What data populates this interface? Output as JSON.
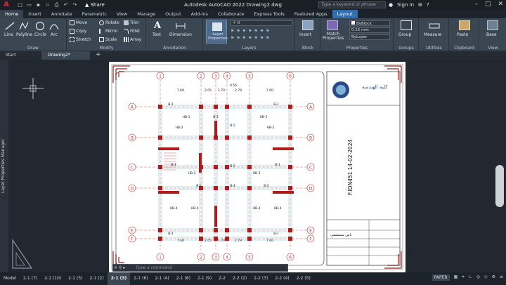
{
  "titlebar": {
    "app_logo": "A",
    "share": "Share",
    "title": "Autodesk AutoCAD 2022    Drawing2.dwg",
    "search_placeholder": "Type a keyword or phrase",
    "sign_in": "Sign In"
  },
  "ribbon_tabs": [
    "Home",
    "Insert",
    "Annotate",
    "Parametric",
    "View",
    "Manage",
    "Output",
    "Add-ins",
    "Collaborate",
    "Express Tools",
    "Featured Apps",
    "Layout"
  ],
  "ribbon": {
    "draw": {
      "line": "Line",
      "polyline": "Polyline",
      "circle": "Circle",
      "arc": "Arc",
      "label": "Draw"
    },
    "modify": {
      "move": "Move",
      "rotate": "Rotate",
      "trim": "Trim",
      "copy": "Copy",
      "mirror": "Mirror",
      "fillet": "Fillet",
      "stretch": "Stretch",
      "scale": "Scale",
      "array": "Array",
      "label": "Modify"
    },
    "annotation": {
      "text": "Text",
      "dimension": "Dimension",
      "label": "Annotation"
    },
    "layers": {
      "layer_properties": "Layer Properties",
      "layer_value": "0",
      "label": "Layers"
    },
    "block": {
      "insert": "Insert",
      "label": "Block"
    },
    "properties": {
      "match": "Match Properties",
      "color": "ByBlock",
      "lineweight": "0.15 mm",
      "linetype": "ByLayer",
      "label": "Properties"
    },
    "groups": {
      "group": "Group",
      "label": "Groups"
    },
    "utilities": {
      "measure": "Measure",
      "label": "Utilities"
    },
    "clipboard": {
      "paste": "Paste",
      "label": "Clipboard"
    },
    "view": {
      "base": "Base",
      "label": "View"
    }
  },
  "file_tabs": [
    "Start",
    "Drawing2*"
  ],
  "side_panel": "Layer Properties Manager",
  "command_placeholder": "Type a command",
  "layout_tabs": [
    "Model",
    "2-1 (7)",
    "2-1 (10)",
    "2-1 (5)",
    "2-1 (2)",
    "2-1 (3)",
    "2-1 (6)",
    "2-1 (4)",
    "2-1 (8)",
    "2-1 (9)",
    "2-2",
    "2-2 (2)",
    "2-2 (3)",
    "2-2 (4)",
    "2-2 (5)"
  ],
  "active_layout": "2-1 (3)",
  "status": {
    "paper": "PAPER"
  },
  "drawing": {
    "top_axes": [
      "1",
      "2",
      "3",
      "4",
      "5",
      "6"
    ],
    "side_axes": [
      "A",
      "B",
      "C",
      "D",
      "E",
      "F"
    ],
    "top_dims": [
      "7.60",
      "2.05",
      "1.70",
      "2.79",
      "7.60"
    ],
    "extra_dim": "0.56",
    "beams": [
      "B-1",
      "B-2",
      "B-3",
      "B-4",
      "B-5",
      "HB-1",
      "HB-2",
      "HB-3",
      "HB-4"
    ],
    "title_code": "F.IDN451 14-02-2024",
    "title_block": {
      "logo_caption": "كلية الهندسة",
      "project": "ناس مستشفى"
    }
  }
}
